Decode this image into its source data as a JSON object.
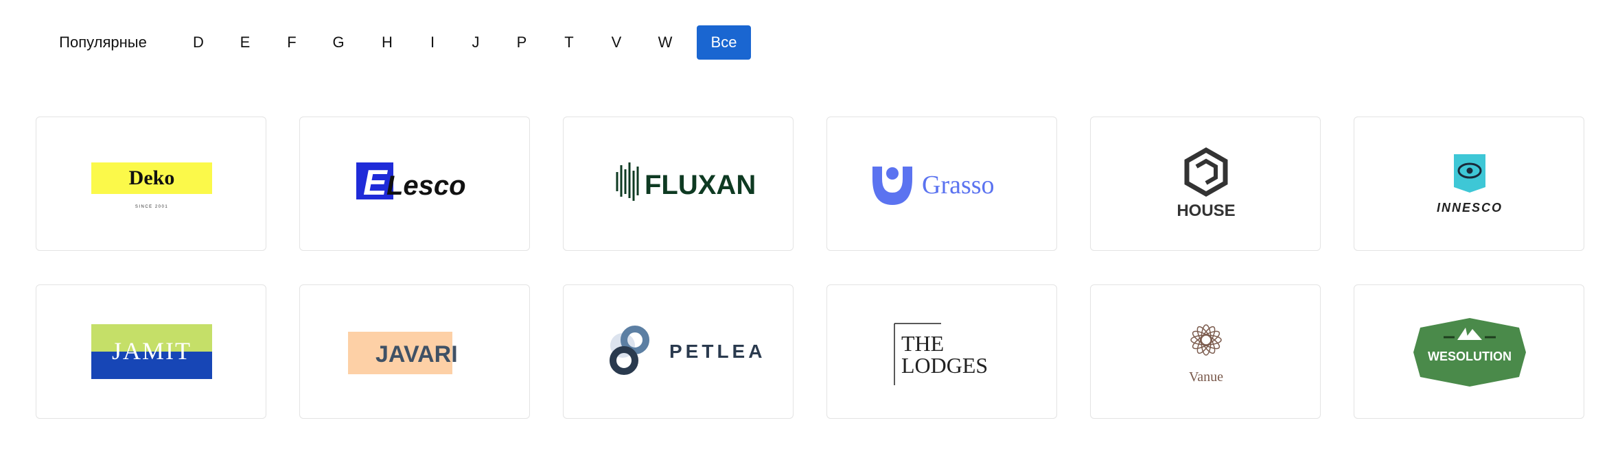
{
  "filters": {
    "popular": "Популярные",
    "letters": [
      "D",
      "E",
      "F",
      "G",
      "H",
      "I",
      "J",
      "P",
      "T",
      "V",
      "W"
    ],
    "all": "Все"
  },
  "brands": [
    {
      "name": "Deko",
      "tagline": "SINCE 2001"
    },
    {
      "name": "Lesco",
      "mark": "E"
    },
    {
      "name": "FLUXAN"
    },
    {
      "name": "Grasso"
    },
    {
      "name": "HOUSE"
    },
    {
      "name": "INNESCO"
    },
    {
      "name": "JAMIT"
    },
    {
      "name": "JAVARI"
    },
    {
      "name": "PETLEA"
    },
    {
      "name": "THE",
      "name2": "LODGES"
    },
    {
      "name": "Vanue"
    },
    {
      "name": "WESOLUTION"
    }
  ],
  "colors": {
    "accent": "#1a66d1",
    "deko_yellow": "#fbf94a",
    "lesco_blue": "#1f2bd8",
    "fluxan_green": "#0e3a22",
    "grasso_blue": "#5b73f0",
    "innesco_teal": "#3ec7d6",
    "jamit_green": "#c5df68",
    "jamit_blue": "#1746b6",
    "javari_peach": "#fdd0a6",
    "javari_slate": "#3f5165",
    "petlea_navy": "#2a3a4e",
    "vanue_brown": "#7a5a4c",
    "wesolution_green": "#4a8a4a"
  }
}
